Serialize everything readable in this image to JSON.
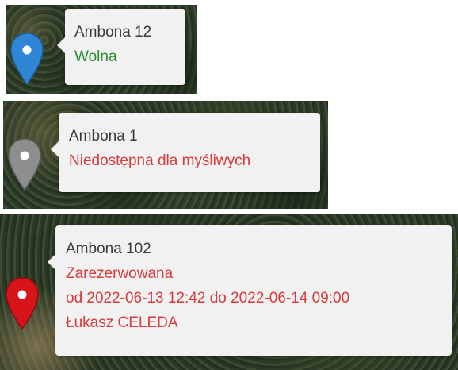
{
  "markers": [
    {
      "title": "Ambona 12",
      "status": "Wolna",
      "status_color": "#2e8b2e",
      "pin_color": "#2f86d4",
      "icon": "map-pin-icon"
    },
    {
      "title": "Ambona 1",
      "status": "Niedostępna dla myśliwych",
      "status_color": "#d93a3a",
      "pin_color": "#8e8e8e",
      "icon": "map-pin-icon"
    },
    {
      "title": "Ambona 102",
      "status": "Zarezerwowana",
      "status_color": "#d93a3a",
      "reservation": "od 2022-06-13 12:42 do 2022-06-14 09:00",
      "hunter": "Łukasz CELEDA",
      "pin_color": "#d8141b",
      "icon": "map-pin-icon"
    }
  ]
}
